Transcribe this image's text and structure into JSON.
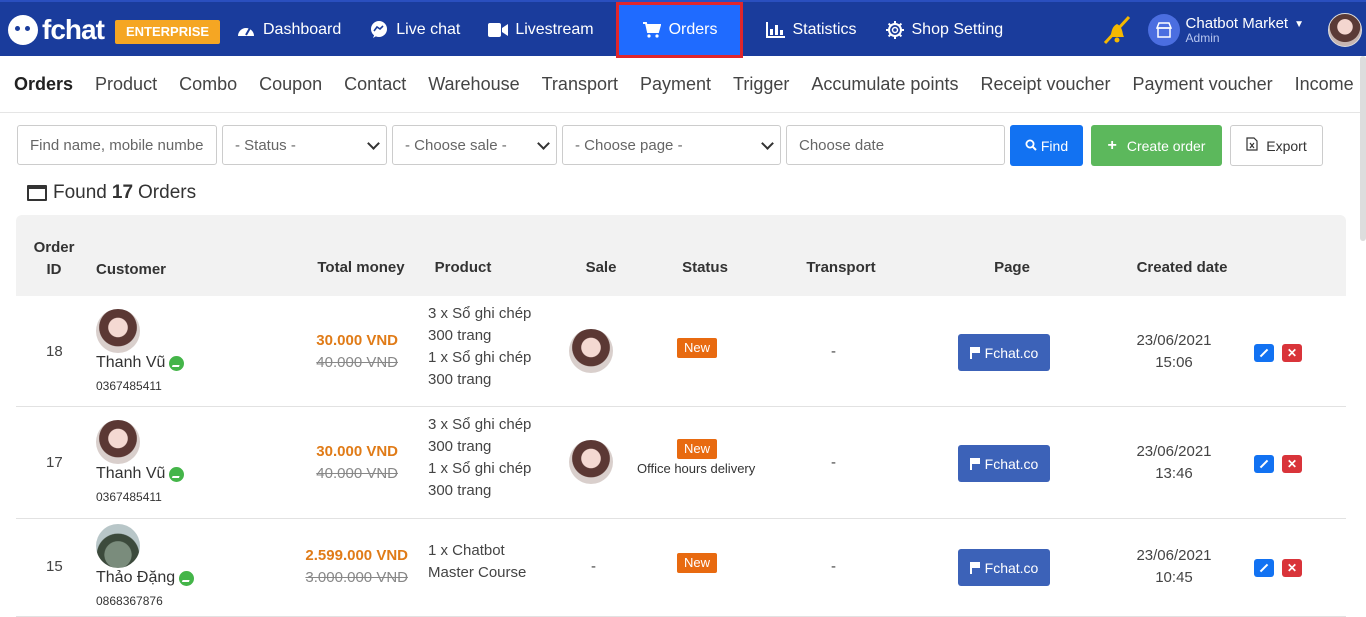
{
  "brand": {
    "logo_text": "fchat",
    "badge": "ENTERPRISE"
  },
  "nav": [
    {
      "label": "Dashboard",
      "icon": "speedometer-icon"
    },
    {
      "label": "Live chat",
      "icon": "messenger-icon"
    },
    {
      "label": "Livestream",
      "icon": "video-icon"
    },
    {
      "label": "Orders",
      "icon": "cart-icon",
      "active": true
    },
    {
      "label": "Statistics",
      "icon": "bar-chart-icon"
    },
    {
      "label": "Shop Setting",
      "icon": "gear-icon"
    }
  ],
  "account": {
    "shop_name": "Chatbot Market",
    "role": "Admin"
  },
  "subnav": [
    "Orders",
    "Product",
    "Combo",
    "Coupon",
    "Contact",
    "Warehouse",
    "Transport",
    "Payment",
    "Trigger",
    "Accumulate points",
    "Receipt voucher",
    "Payment voucher",
    "Income"
  ],
  "filters": {
    "search_placeholder": "Find name, mobile numbe",
    "status": "- Status -",
    "sale": "- Choose sale -",
    "page": "- Choose page -",
    "date_placeholder": "Choose date",
    "find": "Find",
    "create": "Create order",
    "export": "Export"
  },
  "found": {
    "prefix": "Found",
    "count": "17",
    "suffix": "Orders"
  },
  "table": {
    "headers": {
      "order_id": "Order ID",
      "customer": "Customer",
      "total": "Total money",
      "product": "Product",
      "sale": "Sale",
      "status": "Status",
      "transport": "Transport",
      "page": "Page",
      "created": "Created date"
    },
    "rows": [
      {
        "id": "18",
        "customer": "Thanh Vũ",
        "phone": "0367485411",
        "price": "30.000 VND",
        "old_price": "40.000 VND",
        "product_lines": [
          "3 x Sổ ghi chép",
          "300 trang",
          "1 x Sổ ghi chép",
          "300 trang"
        ],
        "status": "New",
        "status_note": "",
        "transport": "-",
        "page": "Fchat.co",
        "date": "23/06/2021",
        "time": "15:06"
      },
      {
        "id": "17",
        "customer": "Thanh Vũ",
        "phone": "0367485411",
        "price": "30.000 VND",
        "old_price": "40.000 VND",
        "product_lines": [
          "3 x Sổ ghi chép",
          "300 trang",
          "1 x Sổ ghi chép",
          "300 trang"
        ],
        "status": "New",
        "status_note": "Office hours delivery",
        "transport": "-",
        "page": "Fchat.co",
        "date": "23/06/2021",
        "time": "13:46"
      },
      {
        "id": "15",
        "customer": "Thảo Đặng",
        "phone": "0868367876",
        "price": "2.599.000 VND",
        "old_price": "3.000.000 VND",
        "product_lines": [
          "1 x Chatbot",
          "Master Course"
        ],
        "sale": "-",
        "status": "New",
        "status_note": "",
        "transport": "-",
        "page": "Fchat.co",
        "date": "23/06/2021",
        "time": "10:45"
      }
    ]
  },
  "colors": {
    "navbar": "#1a3c9c",
    "active_tab": "#1f6bff",
    "highlight": "#e0262b",
    "enterprise": "#f5a623",
    "find": "#1272f2",
    "create": "#5cb85c",
    "new_badge": "#e86a10",
    "price": "#e07b17"
  }
}
